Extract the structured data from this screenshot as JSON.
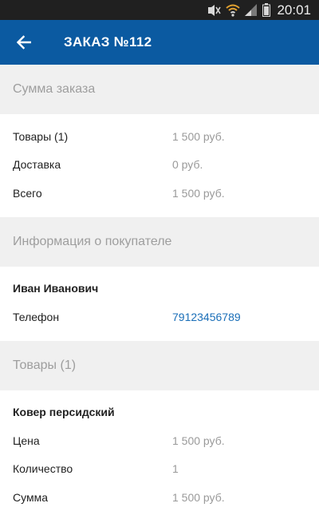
{
  "status_bar": {
    "time": "20:01",
    "icons": [
      "no-sound-icon",
      "wifi-icon",
      "signal-icon",
      "battery-icon"
    ]
  },
  "app_bar": {
    "back_icon": "arrow-left-icon",
    "title": "ЗАКАЗ №112",
    "color": "#0b5aa1"
  },
  "order_summary": {
    "header": "Сумма заказа",
    "rows": [
      {
        "label": "Товары (1)",
        "value": "1 500 руб."
      },
      {
        "label": "Доставка",
        "value": "0 руб."
      },
      {
        "label": "Всего",
        "value": "1 500 руб."
      }
    ]
  },
  "customer_info": {
    "header": "Информация о покупателе",
    "name": "Иван Иванович",
    "phone_label": "Телефон",
    "phone_value": "79123456789"
  },
  "products": {
    "header": "Товары (1)",
    "item_name": "Ковер персидский",
    "rows": [
      {
        "label": "Цена",
        "value": "1 500 руб."
      },
      {
        "label": "Количество",
        "value": "1"
      },
      {
        "label": "Сумма",
        "value": "1 500 руб."
      }
    ]
  }
}
